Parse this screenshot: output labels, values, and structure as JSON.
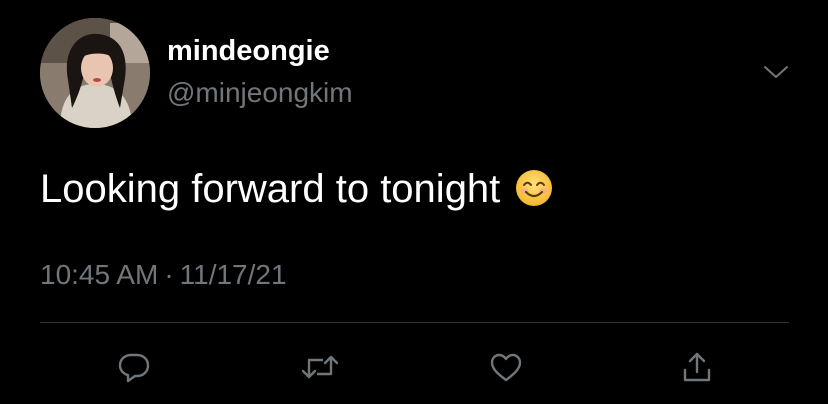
{
  "tweet": {
    "author": {
      "display_name": "mindeongie",
      "handle": "@minjeongkim",
      "avatar_icon": "profile-photo"
    },
    "text": "Looking forward to tonight",
    "emoji": "smiling-face-with-smiling-eyes",
    "time": "10:45 AM",
    "separator": "·",
    "date": "11/17/21"
  },
  "actions": [
    {
      "name": "reply",
      "icon": "comment-bubble-icon"
    },
    {
      "name": "retweet",
      "icon": "retweet-arrows-icon"
    },
    {
      "name": "like",
      "icon": "heart-icon"
    },
    {
      "name": "share",
      "icon": "share-upload-icon"
    }
  ],
  "colors": {
    "background": "#000000",
    "primary_text": "#ffffff",
    "secondary_text": "#71767b",
    "divider": "#2f3336"
  }
}
